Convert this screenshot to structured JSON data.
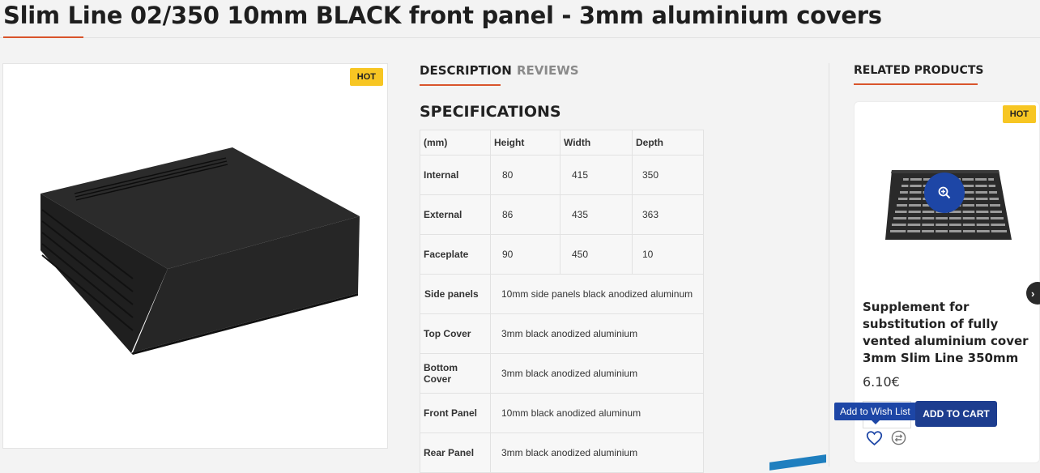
{
  "product": {
    "title": "Slim Line 02/350 10mm BLACK front panel - 3mm aluminium covers",
    "badge": "HOT"
  },
  "tabs": [
    {
      "label": "DESCRIPTION",
      "active": true
    },
    {
      "label": "REVIEWS",
      "active": false
    }
  ],
  "specs": {
    "heading": "SPECIFICATIONS",
    "columns": [
      "(mm)",
      "Height",
      "Width",
      "Depth"
    ],
    "dimension_rows": [
      {
        "label": "Internal",
        "values": [
          "80",
          "415",
          "350"
        ]
      },
      {
        "label": "External",
        "values": [
          "86",
          "435",
          "363"
        ]
      },
      {
        "label": "Faceplate",
        "values": [
          "90",
          "450",
          "10"
        ]
      }
    ],
    "material_rows": [
      {
        "label": "Side panels",
        "value": "10mm side panels black anodized aluminum"
      },
      {
        "label": "Top Cover",
        "value": "3mm black anodized aluminium"
      },
      {
        "label": "Bottom Cover",
        "value": "3mm black anodized aluminium"
      },
      {
        "label": "Front Panel",
        "value": "10mm black anodized aluminum"
      },
      {
        "label": "Rear Panel",
        "value": "3mm black anodized aluminium"
      }
    ]
  },
  "related": {
    "title": "RELATED PRODUCTS",
    "card": {
      "badge": "HOT",
      "name": "Supplement for substitution of fully vented aluminium cover 3mm Slim Line 350mm",
      "price": "6.10€",
      "wish_tooltip": "Add to Wish List",
      "add_to_cart": "ADD TO CART"
    }
  },
  "colors": {
    "accent": "#d9542b",
    "brand_blue": "#1d3d8f",
    "badge": "#f7c623"
  },
  "icons": [
    "zoom-in-icon",
    "heart-icon",
    "compare-icon",
    "chevron-right-icon"
  ]
}
